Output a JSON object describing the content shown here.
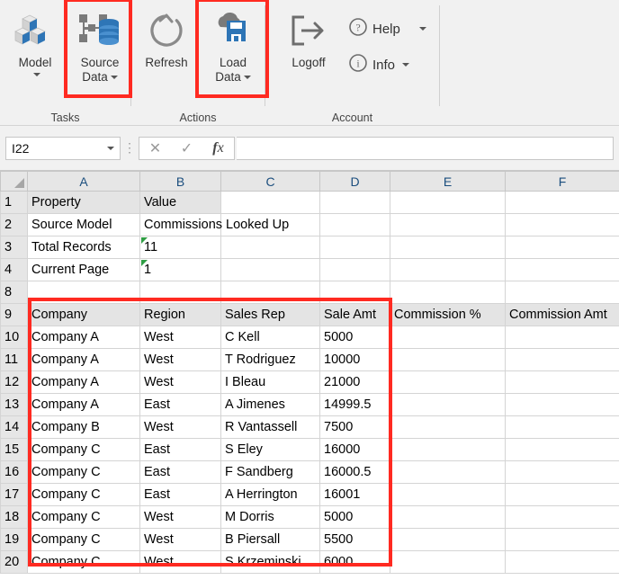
{
  "ribbon": {
    "groups": [
      {
        "label": "Tasks",
        "buttons": [
          {
            "name": "model",
            "label_line1": "Model",
            "label_line2": "",
            "icon": "cubes-3d-icon",
            "has_caret": true,
            "caret_below": true,
            "highlighted": false
          },
          {
            "name": "source-data",
            "label_line1": "Source",
            "label_line2": "Data",
            "icon": "database-nodes-icon",
            "has_caret": true,
            "caret_below": false,
            "highlighted": true
          }
        ]
      },
      {
        "label": "Actions",
        "buttons": [
          {
            "name": "refresh",
            "label_line1": "Refresh",
            "label_line2": "",
            "icon": "refresh-circular-arrow-icon",
            "has_caret": false,
            "caret_below": false,
            "highlighted": false
          },
          {
            "name": "load-data",
            "label_line1": "Load",
            "label_line2": "Data",
            "icon": "cloud-save-floppy-icon",
            "has_caret": true,
            "caret_below": false,
            "highlighted": true
          }
        ]
      },
      {
        "label": "Account",
        "buttons": [
          {
            "name": "logoff",
            "label_line1": "Logoff",
            "label_line2": "",
            "icon": "logoff-exit-arrow-icon",
            "has_caret": false,
            "caret_below": false,
            "highlighted": false
          }
        ],
        "small_buttons": [
          {
            "name": "help",
            "label": "Help",
            "icon": "question-circle-icon",
            "has_caret": true
          },
          {
            "name": "info",
            "label": "Info",
            "icon": "info-circle-icon",
            "has_caret": true
          }
        ]
      }
    ]
  },
  "formula_bar": {
    "name_box_value": "I22",
    "cancel_icon": "cancel-x-icon",
    "enter_icon": "enter-check-icon",
    "function_icon": "insert-function-fx-icon",
    "formula_value": ""
  },
  "grid": {
    "column_headers": [
      "A",
      "B",
      "C",
      "D",
      "E",
      "F"
    ],
    "rows": [
      {
        "num": "1",
        "cells": [
          "Property",
          "Value",
          "",
          "",
          "",
          ""
        ],
        "bold": [
          true,
          true,
          false,
          false,
          false,
          false
        ],
        "fill": [
          true,
          true,
          false,
          false,
          false,
          false
        ],
        "err": [
          false,
          false,
          false,
          false,
          false,
          false
        ],
        "numeric": [
          false,
          false,
          false,
          false,
          false,
          false
        ]
      },
      {
        "num": "2",
        "cells": [
          "Source Model",
          "Commissions Looked Up",
          "",
          "",
          "",
          ""
        ],
        "bold": [
          true,
          false,
          false,
          false,
          false,
          false
        ],
        "fill": [
          false,
          false,
          false,
          false,
          false,
          false
        ],
        "err": [
          false,
          false,
          false,
          false,
          false,
          false
        ],
        "numeric": [
          false,
          false,
          false,
          false,
          false,
          false
        ],
        "spill_b": true
      },
      {
        "num": "3",
        "cells": [
          "Total Records",
          "11",
          "",
          "",
          "",
          ""
        ],
        "bold": [
          true,
          false,
          false,
          false,
          false,
          false
        ],
        "fill": [
          false,
          false,
          false,
          false,
          false,
          false
        ],
        "err": [
          false,
          true,
          false,
          false,
          false,
          false
        ],
        "numeric": [
          false,
          false,
          false,
          false,
          false,
          false
        ]
      },
      {
        "num": "4",
        "cells": [
          "Current Page",
          "1",
          "",
          "",
          "",
          ""
        ],
        "bold": [
          true,
          false,
          false,
          false,
          false,
          false
        ],
        "fill": [
          false,
          false,
          false,
          false,
          false,
          false
        ],
        "err": [
          false,
          true,
          false,
          false,
          false,
          false
        ],
        "numeric": [
          false,
          false,
          false,
          false,
          false,
          false
        ]
      },
      {
        "num": "8",
        "cells": [
          "",
          "",
          "",
          "",
          "",
          ""
        ],
        "bold": [
          false,
          false,
          false,
          false,
          false,
          false
        ],
        "fill": [
          false,
          false,
          false,
          false,
          false,
          false
        ],
        "err": [
          false,
          false,
          false,
          false,
          false,
          false
        ],
        "numeric": [
          false,
          false,
          false,
          false,
          false,
          false
        ]
      },
      {
        "num": "9",
        "cells": [
          "Company",
          "Region",
          "Sales Rep",
          "Sale Amt",
          "Commission %",
          "Commission Amt"
        ],
        "bold": [
          true,
          true,
          true,
          true,
          true,
          true
        ],
        "fill": [
          true,
          true,
          true,
          true,
          true,
          true
        ],
        "err": [
          false,
          false,
          false,
          false,
          false,
          false
        ],
        "numeric": [
          false,
          false,
          false,
          true,
          false,
          false
        ]
      },
      {
        "num": "10",
        "cells": [
          "Company A",
          "West",
          "C Kell",
          "5000",
          "",
          ""
        ],
        "bold": [
          false,
          false,
          false,
          false,
          false,
          false
        ],
        "fill": [
          false,
          false,
          false,
          false,
          false,
          false
        ],
        "err": [
          false,
          false,
          false,
          false,
          false,
          false
        ],
        "numeric": [
          false,
          false,
          false,
          true,
          false,
          false
        ]
      },
      {
        "num": "11",
        "cells": [
          "Company A",
          "West",
          "T Rodriguez",
          "10000",
          "",
          ""
        ],
        "bold": [
          false,
          false,
          false,
          false,
          false,
          false
        ],
        "fill": [
          false,
          false,
          false,
          false,
          false,
          false
        ],
        "err": [
          false,
          false,
          false,
          false,
          false,
          false
        ],
        "numeric": [
          false,
          false,
          false,
          true,
          false,
          false
        ]
      },
      {
        "num": "12",
        "cells": [
          "Company A",
          "West",
          "I Bleau",
          "21000",
          "",
          ""
        ],
        "bold": [
          false,
          false,
          false,
          false,
          false,
          false
        ],
        "fill": [
          false,
          false,
          false,
          false,
          false,
          false
        ],
        "err": [
          false,
          false,
          false,
          false,
          false,
          false
        ],
        "numeric": [
          false,
          false,
          false,
          true,
          false,
          false
        ]
      },
      {
        "num": "13",
        "cells": [
          "Company A",
          "East",
          "A Jimenes",
          "14999.5",
          "",
          ""
        ],
        "bold": [
          false,
          false,
          false,
          false,
          false,
          false
        ],
        "fill": [
          false,
          false,
          false,
          false,
          false,
          false
        ],
        "err": [
          false,
          false,
          false,
          false,
          false,
          false
        ],
        "numeric": [
          false,
          false,
          false,
          true,
          false,
          false
        ]
      },
      {
        "num": "14",
        "cells": [
          "Company B",
          "West",
          "R Vantassell",
          "7500",
          "",
          ""
        ],
        "bold": [
          false,
          false,
          false,
          false,
          false,
          false
        ],
        "fill": [
          false,
          false,
          false,
          false,
          false,
          false
        ],
        "err": [
          false,
          false,
          false,
          false,
          false,
          false
        ],
        "numeric": [
          false,
          false,
          false,
          true,
          false,
          false
        ]
      },
      {
        "num": "15",
        "cells": [
          "Company C",
          "East",
          "S Eley",
          "16000",
          "",
          ""
        ],
        "bold": [
          false,
          false,
          false,
          false,
          false,
          false
        ],
        "fill": [
          false,
          false,
          false,
          false,
          false,
          false
        ],
        "err": [
          false,
          false,
          false,
          false,
          false,
          false
        ],
        "numeric": [
          false,
          false,
          false,
          true,
          false,
          false
        ]
      },
      {
        "num": "16",
        "cells": [
          "Company C",
          "East",
          "F Sandberg",
          "16000.5",
          "",
          ""
        ],
        "bold": [
          false,
          false,
          false,
          false,
          false,
          false
        ],
        "fill": [
          false,
          false,
          false,
          false,
          false,
          false
        ],
        "err": [
          false,
          false,
          false,
          false,
          false,
          false
        ],
        "numeric": [
          false,
          false,
          false,
          true,
          false,
          false
        ]
      },
      {
        "num": "17",
        "cells": [
          "Company C",
          "East",
          "A Herrington",
          "16001",
          "",
          ""
        ],
        "bold": [
          false,
          false,
          false,
          false,
          false,
          false
        ],
        "fill": [
          false,
          false,
          false,
          false,
          false,
          false
        ],
        "err": [
          false,
          false,
          false,
          false,
          false,
          false
        ],
        "numeric": [
          false,
          false,
          false,
          true,
          false,
          false
        ]
      },
      {
        "num": "18",
        "cells": [
          "Company C",
          "West",
          "M Dorris",
          "5000",
          "",
          ""
        ],
        "bold": [
          false,
          false,
          false,
          false,
          false,
          false
        ],
        "fill": [
          false,
          false,
          false,
          false,
          false,
          false
        ],
        "err": [
          false,
          false,
          false,
          false,
          false,
          false
        ],
        "numeric": [
          false,
          false,
          false,
          true,
          false,
          false
        ]
      },
      {
        "num": "19",
        "cells": [
          "Company C",
          "West",
          "B Piersall",
          "5500",
          "",
          ""
        ],
        "bold": [
          false,
          false,
          false,
          false,
          false,
          false
        ],
        "fill": [
          false,
          false,
          false,
          false,
          false,
          false
        ],
        "err": [
          false,
          false,
          false,
          false,
          false,
          false
        ],
        "numeric": [
          false,
          false,
          false,
          true,
          false,
          false
        ]
      },
      {
        "num": "20",
        "cells": [
          "Company C",
          "West",
          "S Krzeminski",
          "6000",
          "",
          ""
        ],
        "bold": [
          false,
          false,
          false,
          false,
          false,
          false
        ],
        "fill": [
          false,
          false,
          false,
          false,
          false,
          false
        ],
        "err": [
          false,
          false,
          false,
          false,
          false,
          false
        ],
        "numeric": [
          false,
          false,
          false,
          true,
          false,
          false
        ]
      }
    ]
  },
  "colors": {
    "highlight": "#ff2a21",
    "accent_blue": "#2e75b6",
    "header_gray": "#e6e6e6",
    "ribbon_bg": "#f1f1f1",
    "col_letter": "#1b4e7e",
    "error_triangle_green": "#2f9e44"
  }
}
